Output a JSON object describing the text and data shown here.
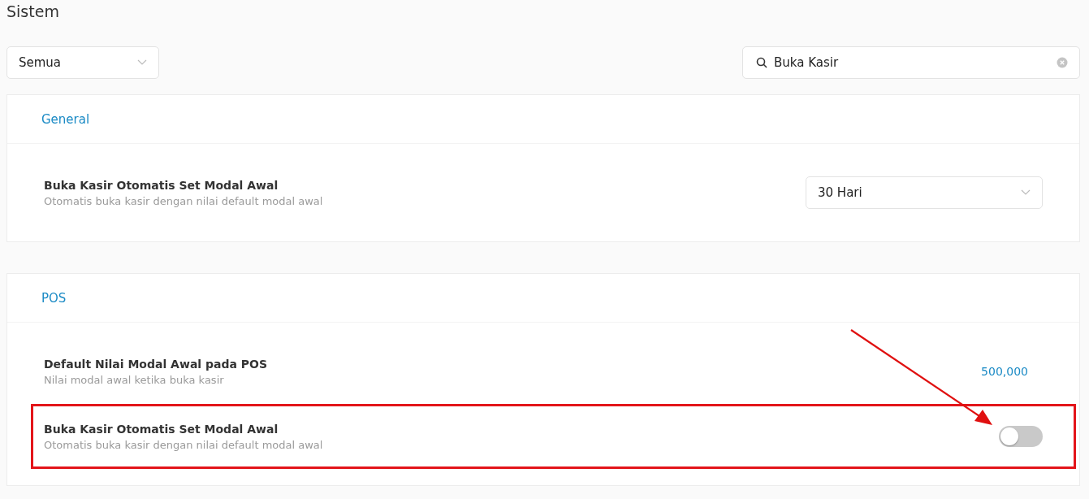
{
  "page_title": "Sistem",
  "filter": {
    "value": "Semua"
  },
  "search": {
    "value": "Buka Kasir"
  },
  "sections": [
    {
      "title": "General",
      "settings": [
        {
          "kind": "select",
          "label": "Buka Kasir Otomatis Set Modal Awal",
          "description": "Otomatis buka kasir dengan nilai default modal awal",
          "value": "30 Hari",
          "highlighted": false
        }
      ]
    },
    {
      "title": "POS",
      "settings": [
        {
          "kind": "value",
          "label": "Default Nilai Modal Awal pada POS",
          "description": "Nilai modal awal ketika buka kasir",
          "value": "500,000",
          "highlighted": false
        },
        {
          "kind": "toggle",
          "label": "Buka Kasir Otomatis Set Modal Awal",
          "description": "Otomatis buka kasir dengan nilai default modal awal",
          "on": false,
          "highlighted": true
        }
      ]
    }
  ]
}
